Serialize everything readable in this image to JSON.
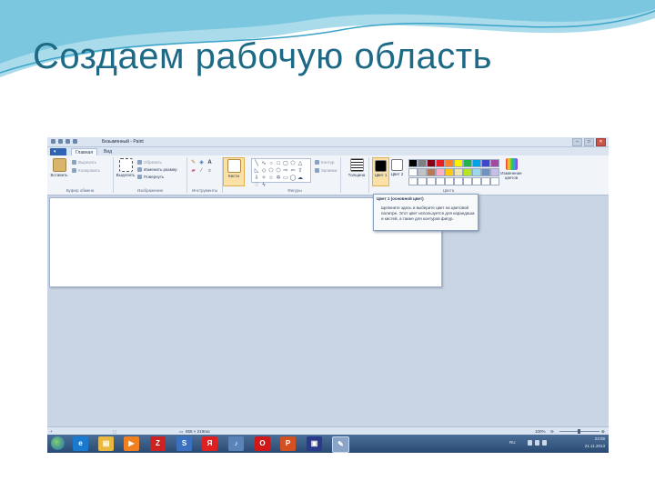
{
  "slide": {
    "title": "Создаем рабочую область"
  },
  "window": {
    "title": "Безымянный - Paint",
    "controls": [
      "–",
      "□",
      "✕"
    ]
  },
  "tabs": {
    "home": "Главная",
    "view": "Вид"
  },
  "ribbon": {
    "clipboard": {
      "group_label": "Буфер обмена",
      "paste": "Вставить",
      "cut": "Вырезать",
      "copy": "Копировать"
    },
    "image": {
      "group_label": "Изображение",
      "select": "Выделить",
      "crop": "Обрезать",
      "resize": "Изменить размер",
      "rotate": "Повернуть"
    },
    "tools": {
      "group_label": "Инструменты",
      "text_tool": "A"
    },
    "brushes": {
      "label": "Кисти"
    },
    "shapes": {
      "group_label": "Фигуры",
      "outline": "Контур",
      "fill": "Заливка"
    },
    "size": {
      "label": "Толщина"
    },
    "colors": {
      "group_label": "Цвета",
      "color1": "Цвет 1",
      "color2": "Цвет 2",
      "edit_colors": "Изменение цветов",
      "color1_value": "#000000",
      "color2_value": "#ffffff",
      "palette": [
        "#000000",
        "#7f7f7f",
        "#880015",
        "#ed1c24",
        "#ff7f27",
        "#fff200",
        "#22b14c",
        "#00a2e8",
        "#3f48cc",
        "#a349a4",
        "#ffffff",
        "#c3c3c3",
        "#b97a57",
        "#ffaec9",
        "#ffc90e",
        "#efe4b0",
        "#b5e61d",
        "#99d9ea",
        "#7092be",
        "#c8bfe7",
        "#ffffff",
        "#ffffff",
        "#ffffff",
        "#ffffff",
        "#ffffff",
        "#ffffff",
        "#ffffff",
        "#ffffff",
        "#ffffff",
        "#ffffff"
      ]
    }
  },
  "tooltip": {
    "title": "Цвет 1 (основной цвет)",
    "body": "Щелкните здесь и выберите цвет на цветовой палитре. Этот цвет используется для карандаша и кистей, а также для контуров фигур."
  },
  "status": {
    "dimensions": "855 × 219пкс",
    "zoom": "100%"
  },
  "taskbar": {
    "language": "RU",
    "time": "23:08",
    "date": "21.11.2013"
  }
}
